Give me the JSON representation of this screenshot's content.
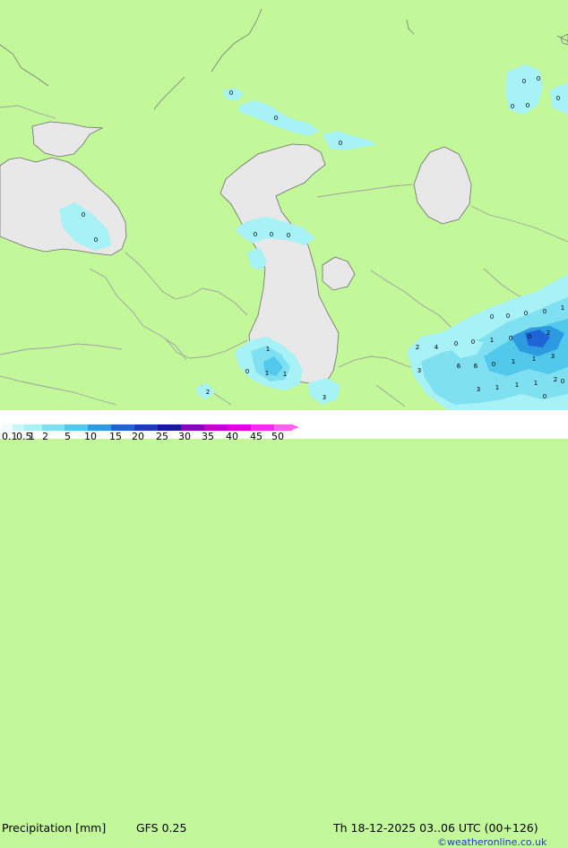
{
  "colors": {
    "land": "#c2f79a",
    "water": "#e8e8e8",
    "precip_light": "#a6f2f6",
    "precip_mid": "#7ee0f0",
    "precip_heavy": "#3aa0e6",
    "precip_max": "#1e64d6",
    "border": "#a0a0a0"
  },
  "legend": {
    "title": "Precipitation [mm]",
    "model": "GFS 0.25",
    "valid": "Th 18-12-2025 03..06 UTC (00+126)",
    "credit": "©weatheronline.co.uk",
    "ticks": [
      "0.1",
      "0.5",
      "1",
      "2",
      "5",
      "10",
      "15",
      "20",
      "25",
      "30",
      "35",
      "40",
      "45",
      "50"
    ],
    "colors": [
      "#f0fdfe",
      "#c8f7fa",
      "#a6f2f6",
      "#7ee0f0",
      "#52c8ec",
      "#2e9ae0",
      "#1e64d6",
      "#1a3cc8",
      "#1a1aa0",
      "#8a00c8",
      "#c000d0",
      "#e000e0",
      "#f030e8",
      "#ff60f0"
    ]
  },
  "map_labels": [
    {
      "text": "0"
    },
    {
      "text": "0"
    },
    {
      "text": "0"
    },
    {
      "text": "0"
    },
    {
      "text": "0"
    },
    {
      "text": "0"
    },
    {
      "text": "0"
    },
    {
      "text": "0"
    },
    {
      "text": "0"
    },
    {
      "text": "0"
    },
    {
      "text": "0"
    },
    {
      "text": "0"
    },
    {
      "text": "0"
    },
    {
      "text": "0"
    },
    {
      "text": "0"
    },
    {
      "text": "0"
    },
    {
      "text": "0"
    },
    {
      "text": "1"
    },
    {
      "text": "2"
    },
    {
      "text": "4"
    },
    {
      "text": "0"
    },
    {
      "text": "0"
    },
    {
      "text": "1"
    },
    {
      "text": "0"
    },
    {
      "text": "0"
    },
    {
      "text": "2"
    },
    {
      "text": "3"
    },
    {
      "text": "6"
    },
    {
      "text": "6"
    },
    {
      "text": "0"
    },
    {
      "text": "1"
    },
    {
      "text": "1"
    },
    {
      "text": "3"
    },
    {
      "text": "3"
    },
    {
      "text": "1"
    },
    {
      "text": "1"
    },
    {
      "text": "1"
    },
    {
      "text": "2"
    },
    {
      "text": "1"
    },
    {
      "text": "0"
    },
    {
      "text": "1"
    },
    {
      "text": "1"
    },
    {
      "text": "2"
    },
    {
      "text": "3"
    },
    {
      "text": "0"
    },
    {
      "text": "0"
    }
  ]
}
